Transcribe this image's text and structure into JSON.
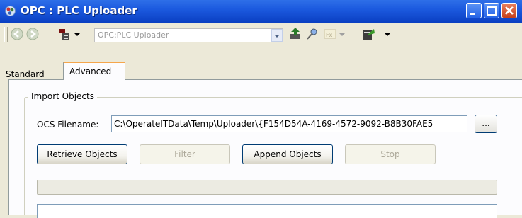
{
  "window": {
    "title": "OPC : PLC Uploader"
  },
  "toolbar": {
    "address": "OPC:PLC Uploader"
  },
  "tabs": [
    {
      "label": "Standard",
      "active": false
    },
    {
      "label": "Advanced",
      "active": true
    }
  ],
  "import_group": {
    "legend": "Import Objects",
    "filename_label": "OCS Filename:",
    "filename_value": "C:\\OperateITData\\Temp\\Uploader\\{F154D54A-4169-4572-9092-B8B30FAE5",
    "browse_label": "...",
    "buttons": {
      "retrieve": "Retrieve Objects",
      "filter": "Filter",
      "append": "Append Objects",
      "stop": "Stop"
    },
    "progress": 0
  },
  "colors": {
    "titlebar": "#0a3fc2",
    "tab_highlight": "#f5a64b",
    "face": "#ece9d8"
  }
}
